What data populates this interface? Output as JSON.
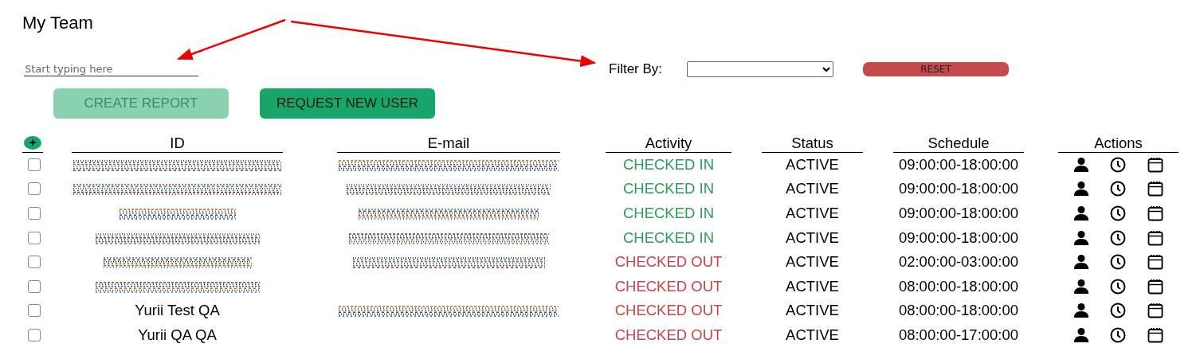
{
  "page": {
    "title": "My Team"
  },
  "search": {
    "placeholder": "Start typing here"
  },
  "filter": {
    "label": "Filter By:"
  },
  "reset_button": {
    "label": "RESET"
  },
  "toolbar": [
    {
      "label": "CREATE REPORT",
      "disabled": true
    },
    {
      "label": "REQUEST NEW USER",
      "disabled": false
    }
  ],
  "table": {
    "add_button": "+",
    "columns": [
      "ID",
      "E-mail",
      "Activity",
      "Status",
      "Schedule",
      "Actions"
    ],
    "rows": [
      {
        "checked": false,
        "id": {
          "kind": "redacted"
        },
        "email": {
          "kind": "redacted"
        },
        "activity": {
          "text": "CHECKED IN",
          "kind": "in"
        },
        "status": "ACTIVE",
        "schedule": "09:00:00-18:00:00"
      },
      {
        "checked": false,
        "id": {
          "kind": "redacted"
        },
        "email": {
          "kind": "redacted"
        },
        "activity": {
          "text": "CHECKED IN",
          "kind": "in"
        },
        "status": "ACTIVE",
        "schedule": "09:00:00-18:00:00"
      },
      {
        "checked": false,
        "id": {
          "kind": "redacted"
        },
        "email": {
          "kind": "redacted"
        },
        "activity": {
          "text": "CHECKED IN",
          "kind": "in"
        },
        "status": "ACTIVE",
        "schedule": "09:00:00-18:00:00"
      },
      {
        "checked": false,
        "id": {
          "kind": "redacted"
        },
        "email": {
          "kind": "redacted"
        },
        "activity": {
          "text": "CHECKED IN",
          "kind": "in"
        },
        "status": "ACTIVE",
        "schedule": "09:00:00-18:00:00"
      },
      {
        "checked": false,
        "id": {
          "kind": "redacted"
        },
        "email": {
          "kind": "redacted"
        },
        "activity": {
          "text": "CHECKED OUT",
          "kind": "out"
        },
        "status": "ACTIVE",
        "schedule": "02:00:00-03:00:00"
      },
      {
        "checked": false,
        "id": {
          "kind": "redacted"
        },
        "activity": {
          "text": "CHECKED OUT",
          "kind": "out"
        },
        "status": "ACTIVE",
        "schedule": "08:00:00-18:00:00"
      },
      {
        "checked": false,
        "id": {
          "kind": "text",
          "text": "Yurii Test QA"
        },
        "email": {
          "kind": "redacted"
        },
        "activity": {
          "text": "CHECKED OUT",
          "kind": "out"
        },
        "status": "ACTIVE",
        "schedule": "08:00:00-18:00:00"
      },
      {
        "checked": false,
        "id": {
          "kind": "text",
          "text": "Yurii QA QA"
        },
        "activity": {
          "text": "CHECKED OUT",
          "kind": "out"
        },
        "status": "ACTIVE",
        "schedule": "08:00:00-17:00:00"
      }
    ]
  }
}
